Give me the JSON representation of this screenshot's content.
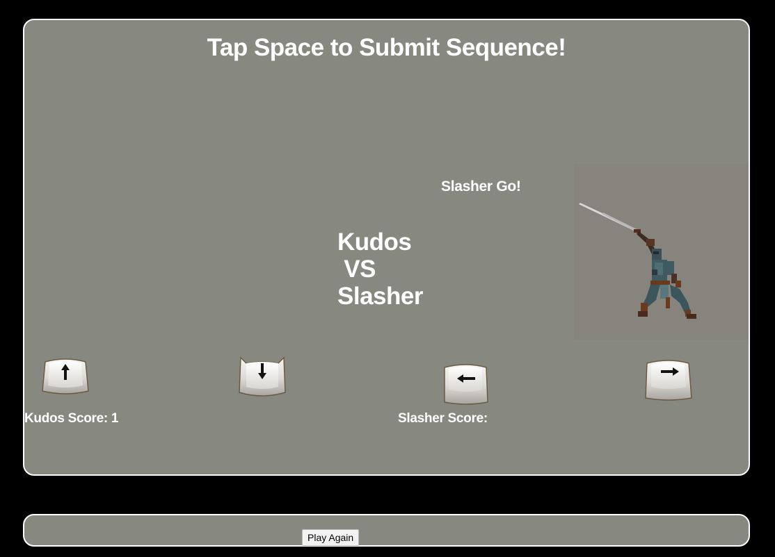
{
  "game": {
    "title": "Tap Space to Submit Sequence!",
    "turn_message": "Slasher Go!",
    "versus_text": "Kudos\n VS\nSlasher",
    "player1": {
      "name": "Kudos",
      "score_label": "Kudos Score: 1"
    },
    "player2": {
      "name": "Slasher",
      "score_label": "Slasher Score:"
    },
    "sequence_keys": [
      {
        "icon": "arrow-up-key-icon",
        "direction": "up"
      },
      {
        "icon": "arrow-down-key-icon",
        "direction": "down"
      },
      {
        "icon": "arrow-left-key-icon",
        "direction": "left"
      },
      {
        "icon": "arrow-right-key-icon",
        "direction": "right"
      }
    ],
    "fighter_icon": "ninja-swordsman-sprite"
  },
  "controls": {
    "play_again_label": "Play Again"
  },
  "colors": {
    "background": "#000000",
    "stage": "#878981",
    "border": "#ffffff",
    "text": "#ffffff"
  }
}
